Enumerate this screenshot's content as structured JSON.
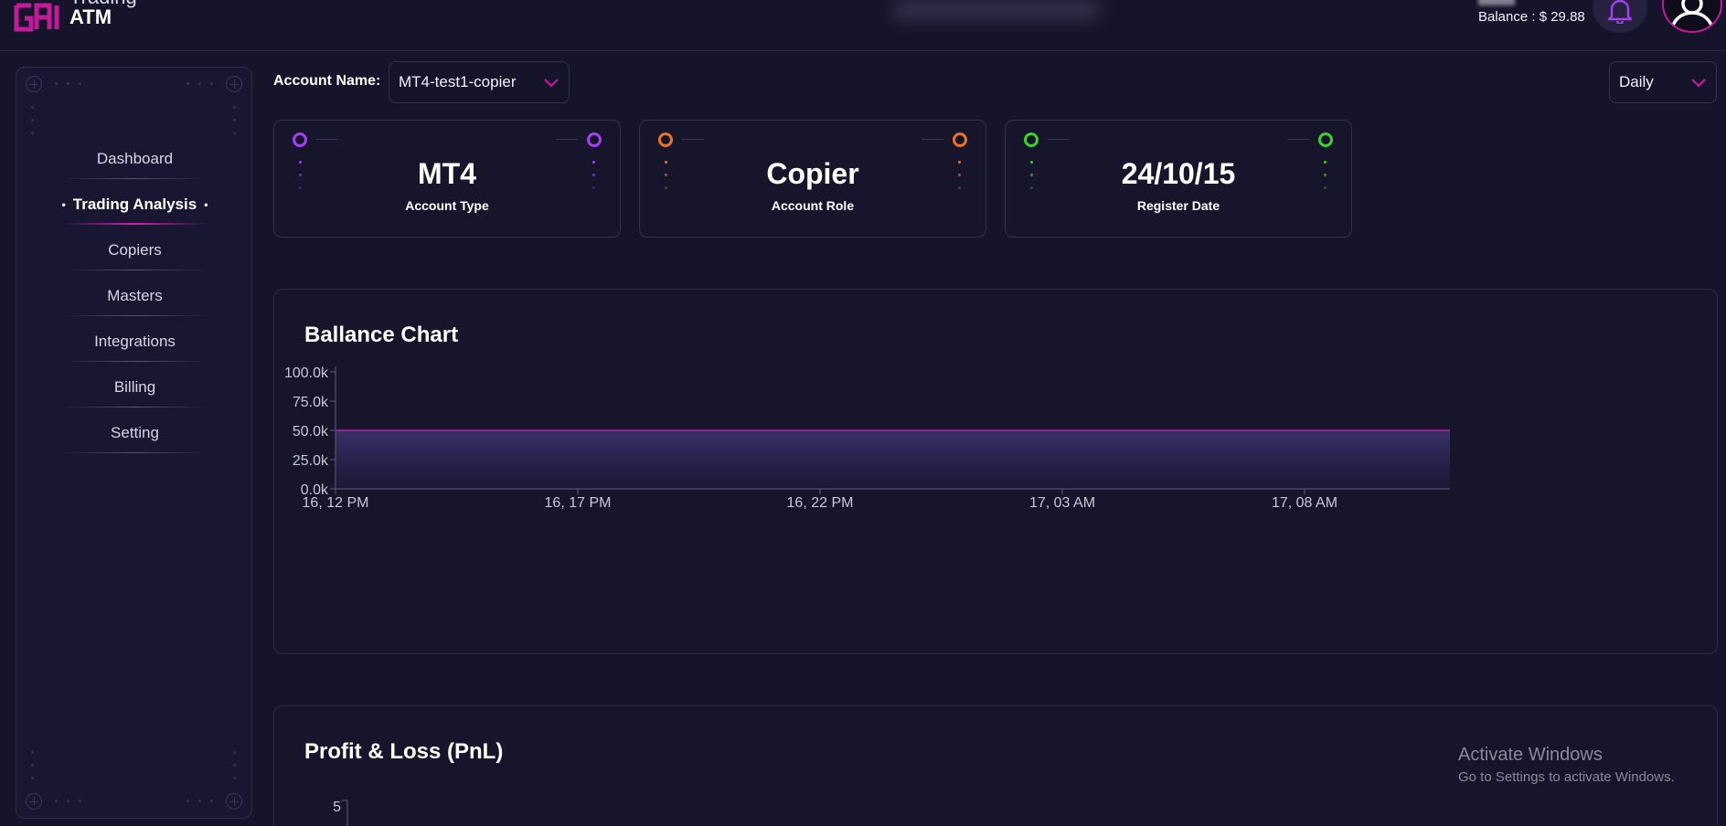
{
  "header": {
    "brand_top": "Trading",
    "brand": "ATM",
    "balance_label": "Balance : $ 29.88",
    "accent": "#c21a9a"
  },
  "sidebar": {
    "items": [
      {
        "label": "Dashboard",
        "active": false
      },
      {
        "label": "Trading Analysis",
        "active": true
      },
      {
        "label": "Copiers",
        "active": false
      },
      {
        "label": "Masters",
        "active": false
      },
      {
        "label": "Integrations",
        "active": false
      },
      {
        "label": "Billing",
        "active": false
      },
      {
        "label": "Setting",
        "active": false
      }
    ]
  },
  "filters": {
    "account_label": "Account Name:",
    "account_value": "MT4-test1-copier",
    "period_value": "Daily"
  },
  "cards": [
    {
      "value": "MT4",
      "label": "Account Type",
      "color": "#a142f0"
    },
    {
      "value": "Copier",
      "label": "Account Role",
      "color": "#e8732a"
    },
    {
      "value": "24/10/15",
      "label": "Register Date",
      "color": "#3fd12a"
    }
  ],
  "balance_chart": {
    "title": "Ballance Chart"
  },
  "pnl_chart": {
    "title": "Profit & Loss (PnL)",
    "y_tick_top": "5"
  },
  "chart_data": {
    "type": "area",
    "title": "Ballance Chart",
    "x": [
      "16, 12 PM",
      "16, 17 PM",
      "16, 22 PM",
      "17, 03 AM",
      "17, 08 AM"
    ],
    "x_numeric_hours": [
      0,
      5,
      10,
      15,
      20,
      23
    ],
    "series": [
      {
        "values": [
          50000,
          50000,
          50000,
          50000,
          50000,
          50000
        ]
      }
    ],
    "y_ticks": [
      "0.0k",
      "25.0k",
      "50.0k",
      "75.0k",
      "100.0k"
    ],
    "ylim": [
      0,
      100000
    ],
    "grid": false,
    "line_color": "#b3249e"
  },
  "watermark": {
    "title": "Activate Windows",
    "subtitle": "Go to Settings to activate Windows."
  }
}
